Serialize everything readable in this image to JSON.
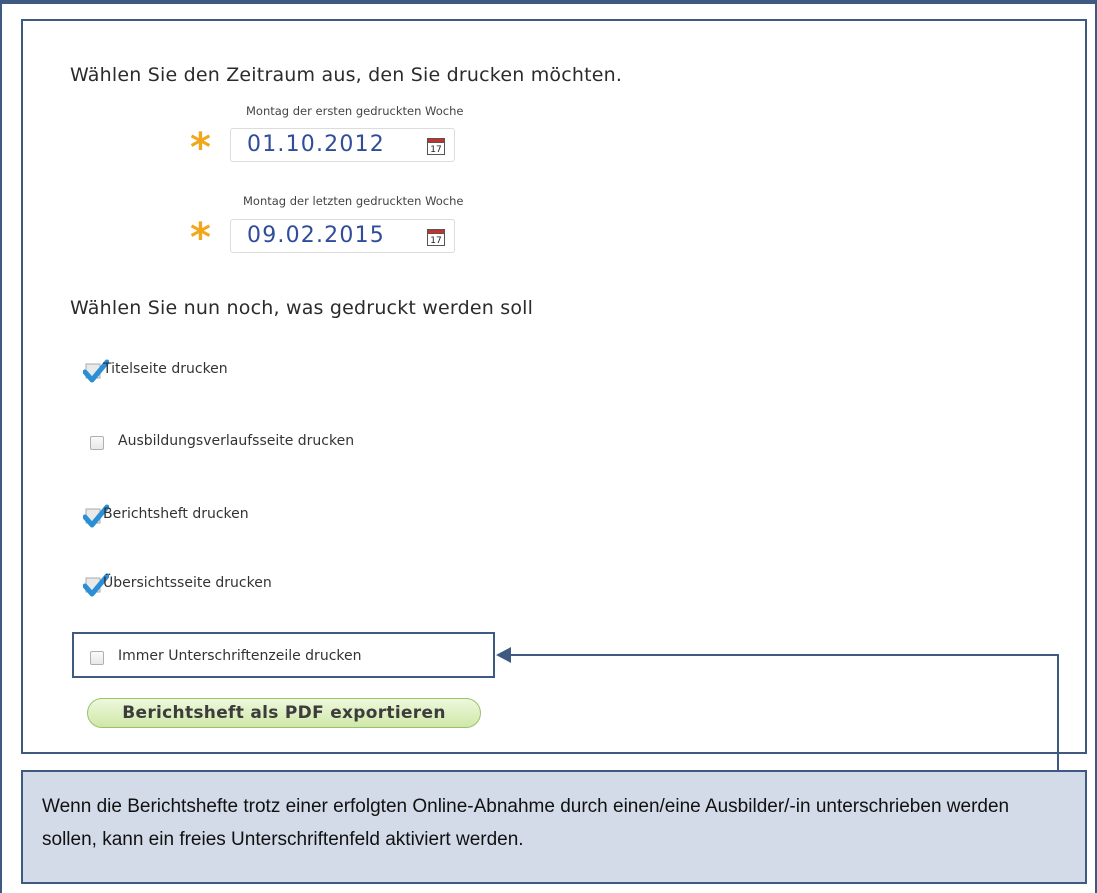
{
  "period": {
    "heading": "Wählen Sie den Zeitraum aus, den Sie drucken möchten.",
    "start_label": "Montag der ersten gedruckten Woche",
    "start_value": "01.10.2012",
    "end_label": "Montag der letzten gedruckten Woche",
    "end_value": "09.02.2015",
    "required_marker": "*",
    "calendar_icon_day": "17"
  },
  "options": {
    "heading": "Wählen Sie nun noch, was gedruckt werden soll",
    "items": [
      {
        "label": "Titelseite drucken",
        "checked": true
      },
      {
        "label": "Ausbildungsverlaufsseite drucken",
        "checked": false
      },
      {
        "label": "Berichtsheft drucken",
        "checked": true
      },
      {
        "label": "Übersichtsseite drucken",
        "checked": true
      },
      {
        "label": "Immer Unterschriftenzeile drucken",
        "checked": false
      }
    ]
  },
  "export_button": "Berichtsheft als PDF exportieren",
  "callout": "Wenn die Berichtshefte trotz einer erfolgten Online-Abnahme durch einen/eine Ausbilder/-in unterschrieben werden sollen, kann ein freies Unterschriftenfeld aktiviert werden.",
  "colors": {
    "frame": "#3f5a80",
    "callout_bg": "#d3dbe9",
    "date_text": "#2f4d9a",
    "asterisk": "#f2a71b",
    "check": "#2a8fd6",
    "button_green": "#cfe8a8"
  }
}
